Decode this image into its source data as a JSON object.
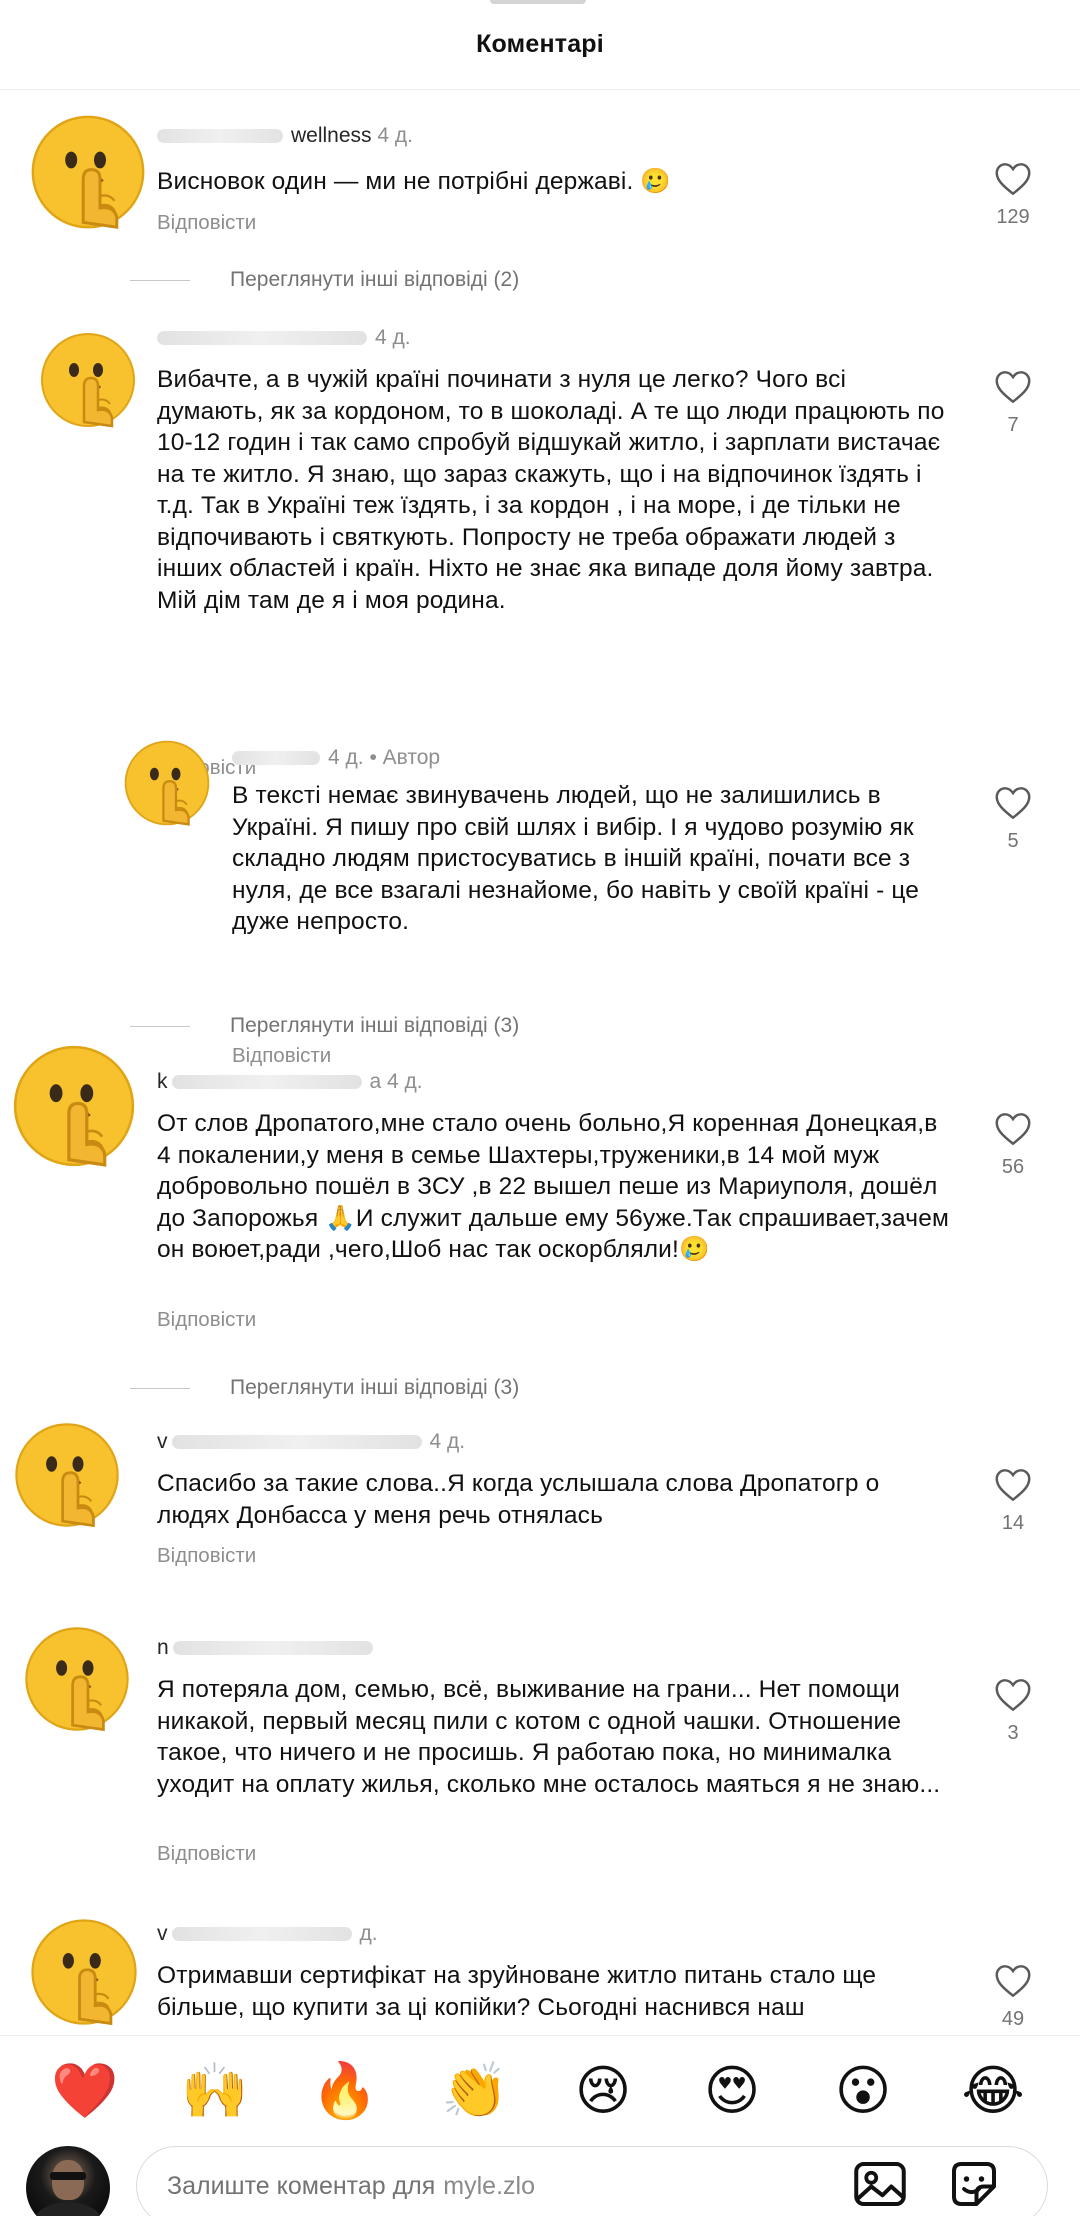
{
  "header": {
    "title": "Коментарі"
  },
  "reply_label": "Відповісти",
  "comments": [
    {
      "username": "wellness",
      "time": "4 д.",
      "text": "Висновок один — ми не потрібні державі. 🥲",
      "likes": "129"
    },
    {
      "username": "",
      "time": "4 д.",
      "text": "Вибачте, а в чужій країні починати з нуля це легко? Чого всі думають, як за кордоном, то в  шоколаді. А те що люди працюють по 10-12 годин і так само спробуй відшукай житло, і зарплати вистачає на те житло. Я знаю, що зараз скажуть, що і на відпочинок їздять і т.д. Так в Україні теж їздять, і за кордон , і на море, і де тільки не відпочивають і святкують. Попросту не треба ображати людей з інших областей і країн. Ніхто не знає яка випаде доля йому завтра. Мій дім там де я і моя родина.",
      "likes": "7"
    },
    {
      "username": "",
      "time": "4 д.",
      "author_badge": "• Автор",
      "text": "В тексті немає звинувачень людей, що не залишились в Україні. Я пишу про свій шлях і вибір. І я чудово розумію як складно людям пристосуватись в іншій країні, почати все з нуля, де все взагалі незнайоме, бо навіть у своїй країні - це дуже непросто.",
      "likes": "5"
    },
    {
      "username": "k",
      "time": "а 4 д.",
      "text": "От слов Дропатого,мне стало очень больно,Я коренная Донецкая,в 4 покалении,у меня в семье Шахтеры,труженики,в 14 мой муж добровольно пошёл в ЗСУ ,в 22 вышел пеше из Мариуполя, дошёл до Запорожья 🙏И служит дальше ему 56уже.Так спрашивает,зачем он воюет,ради ,чего,Шоб нас так оскорбляли!🥲",
      "likes": "56"
    },
    {
      "username": "v",
      "time": "4 д.",
      "text": "Спасибо за такие слова..Я когда услышала слова Дропатогр о людях Донбасса у меня речь отнялась",
      "likes": "14"
    },
    {
      "username": "n",
      "time": "",
      "text": "Я потеряла дом, семью, всё, выживание на грани... Нет помощи никакой, первый месяц пили с котом с одной чашки. Отношение такое, что ничего и не просишь. Я работаю пока, но минималка уходит на оплату жилья, сколько мне осталось маяться я не знаю...",
      "likes": "3"
    },
    {
      "username": "v",
      "time": "д.",
      "text": "Отримавши сертифікат на зруйноване житло питань стало ще більше, що купити за ці копійки? Сьогодні наснився наш",
      "likes": "49"
    }
  ],
  "more_replies": [
    "Переглянути інші відповіді (2)",
    "Переглянути інші відповіді (3)",
    "Переглянути інші відповіді (3)"
  ],
  "reactions": [
    "❤️",
    "🙌",
    "🔥",
    "👏",
    "😢",
    "😍",
    "😮",
    "😂"
  ],
  "composer": {
    "placeholder": "Залиште коментар для",
    "target_user": "myle.zlo"
  },
  "icons": {
    "heart": "heart-outline-icon",
    "gallery": "image-gallery-icon",
    "sticker": "sticker-icon"
  },
  "colors": {
    "text": "#111111",
    "meta": "#8e8e8e",
    "reaction_heart": "#ed2d3f",
    "emoji_yellow": "#f7c22e"
  }
}
